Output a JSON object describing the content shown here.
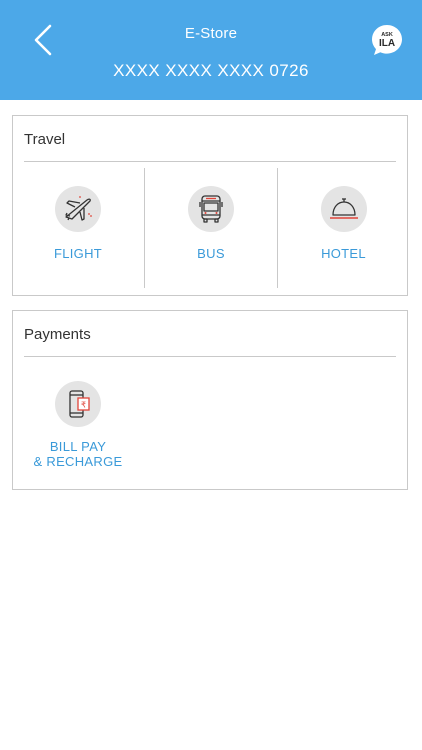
{
  "header": {
    "title": "E-Store",
    "card_number": "XXXX XXXX XXXX 0726",
    "ask_badge": {
      "line1": "ASK",
      "line2": "ILA"
    },
    "background": "#4ca8e8"
  },
  "travel": {
    "title": "Travel",
    "items": [
      {
        "label": "FLIGHT",
        "icon": "airplane-icon"
      },
      {
        "label": "BUS",
        "icon": "bus-icon"
      },
      {
        "label": "HOTEL",
        "icon": "hotel-bell-icon"
      }
    ]
  },
  "payments": {
    "title": "Payments",
    "items": [
      {
        "label_line1": "BILL PAY",
        "label_line2": "& RECHARGE",
        "icon": "mobile-rupee-icon"
      }
    ]
  },
  "colors": {
    "accent": "#3a9ad9",
    "icon_red": "#e0453a",
    "border": "#c9c9c9"
  }
}
